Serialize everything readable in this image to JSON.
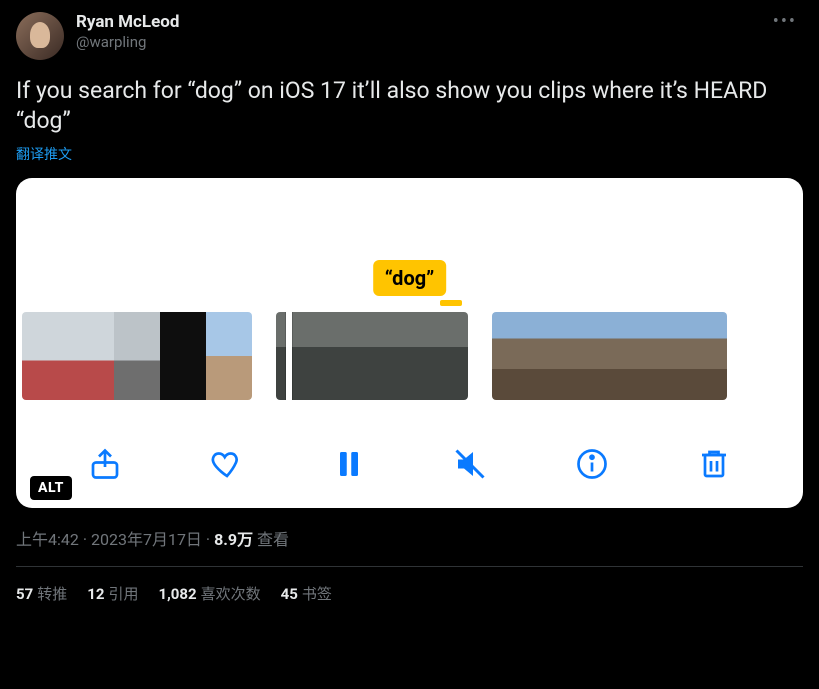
{
  "author": {
    "display_name": "Ryan McLeod",
    "handle": "@warpling"
  },
  "body": "If you search for “dog” on iOS 17 it’ll also show you clips where it’s HEARD “dog”",
  "translate_label": "翻译推文",
  "media": {
    "search_label": "“dog”",
    "alt_badge": "ALT"
  },
  "meta": {
    "time": "上午4:42",
    "dot1": " · ",
    "date": "2023年7月17日",
    "dot2": " · ",
    "views_num": "8.9万",
    "views_label": " 查看"
  },
  "stats": {
    "retweets_num": "57",
    "retweets_label": "转推",
    "quotes_num": "12",
    "quotes_label": "引用",
    "likes_num": "1,082",
    "likes_label": "喜欢次数",
    "bookmarks_num": "45",
    "bookmarks_label": "书签"
  }
}
